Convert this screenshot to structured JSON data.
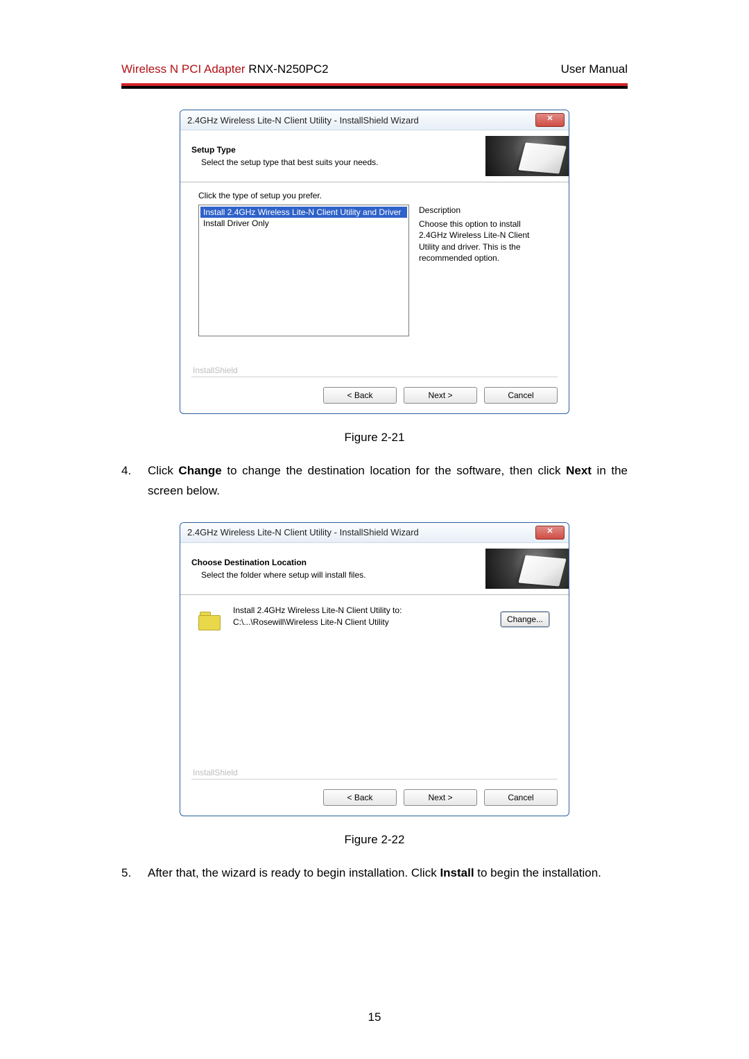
{
  "header": {
    "title_red": "Wireless N PCI Adapter",
    "title_rest": " RNX-N250PC2",
    "right": "User Manual"
  },
  "dialog1": {
    "title": "2.4GHz Wireless Lite-N Client Utility - InstallShield Wizard",
    "heading": "Setup Type",
    "sub": "Select the setup type that best suits your needs.",
    "prefer": "Click the type of setup you prefer.",
    "opt_selected": "Install 2.4GHz Wireless Lite-N Client Utility and Driver",
    "opt_other": "Install Driver Only",
    "desc_head": "Description",
    "desc_body": "Choose this option to install 2.4GHz Wireless Lite-N Client Utility and driver. This is the recommended option.",
    "ishield": "InstallShield",
    "back": "< Back",
    "next": "Next >",
    "cancel": "Cancel"
  },
  "fig1": "Figure 2-21",
  "step4": {
    "num": "4.",
    "pre": "Click ",
    "b1": "Change",
    "mid": " to change the destination location for the software, then click ",
    "b2": "Next",
    "post": " in the screen below."
  },
  "dialog2": {
    "title": "2.4GHz Wireless Lite-N Client Utility - InstallShield Wizard",
    "heading": "Choose Destination Location",
    "sub": "Select the folder where setup will install files.",
    "line1": "Install 2.4GHz Wireless Lite-N Client Utility to:",
    "path": "C:\\...\\Rosewill\\Wireless Lite-N Client Utility",
    "change": "Change...",
    "ishield": "InstallShield",
    "back": "< Back",
    "next": "Next >",
    "cancel": "Cancel"
  },
  "fig2": "Figure 2-22",
  "step5": {
    "num": "5.",
    "pre": "After that, the wizard is ready to begin installation. Click ",
    "b1": "Install",
    "post": " to begin the installation."
  },
  "page_number": "15"
}
